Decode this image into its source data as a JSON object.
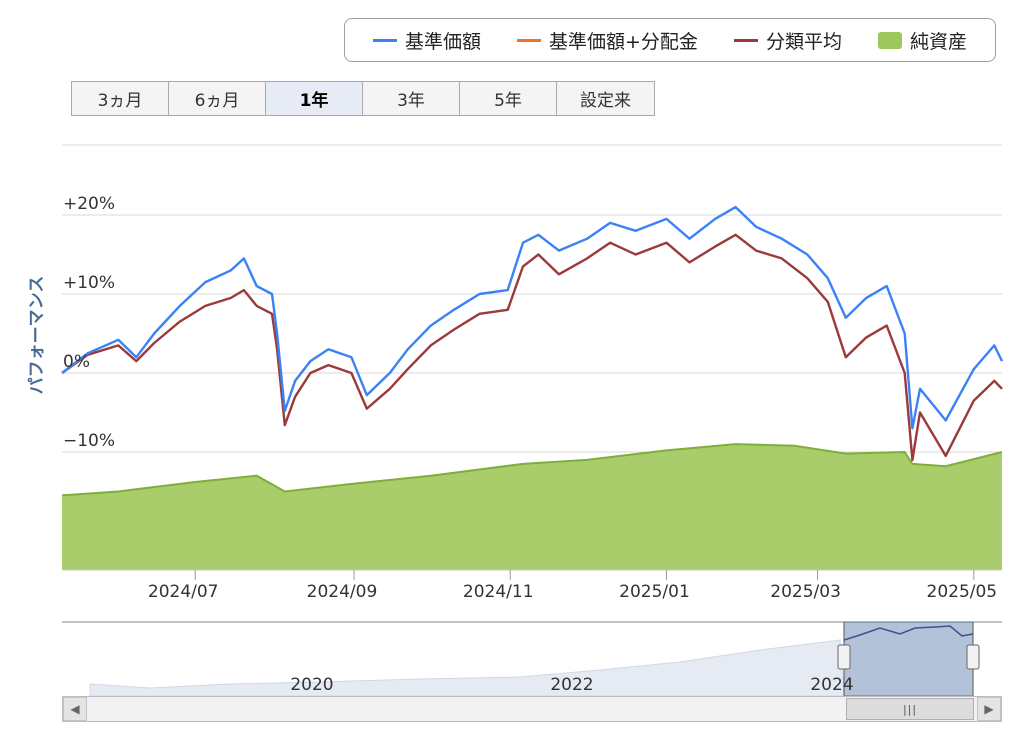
{
  "legend": [
    {
      "label": "基準価額",
      "color": "#3b82f6",
      "kind": "line"
    },
    {
      "label": "基準価額+分配金",
      "color": "#f07030",
      "kind": "line"
    },
    {
      "label": "分類平均",
      "color": "#9b3a3a",
      "kind": "line"
    },
    {
      "label": "純資産",
      "color": "#9cc75a",
      "kind": "area"
    }
  ],
  "range_buttons": [
    {
      "label": "3ヵ月",
      "active": false
    },
    {
      "label": "6ヵ月",
      "active": false
    },
    {
      "label": "1年",
      "active": true
    },
    {
      "label": "3年",
      "active": false
    },
    {
      "label": "5年",
      "active": false
    },
    {
      "label": "設定来",
      "active": false
    }
  ],
  "chart_data": {
    "type": "line",
    "ylabel": "パフォーマンス",
    "ylim": [
      -10,
      25
    ],
    "y_ticks": [
      "+20%",
      "+10%",
      "0%",
      "−10%"
    ],
    "x_ticks": [
      "2024/07",
      "2024/09",
      "2024/11",
      "2025/01",
      "2025/03",
      "2025/05"
    ],
    "x_range": [
      "2024-05-10",
      "2025-05-12"
    ],
    "grid": true,
    "legend_placement": "top-right",
    "series": [
      {
        "name": "基準価額",
        "color": "#3b82f6",
        "points": [
          [
            "2024-05-10",
            0.0
          ],
          [
            "2024-05-20",
            2.5
          ],
          [
            "2024-06-01",
            4.2
          ],
          [
            "2024-06-08",
            2.0
          ],
          [
            "2024-06-15",
            5.0
          ],
          [
            "2024-06-25",
            8.5
          ],
          [
            "2024-07-05",
            11.5
          ],
          [
            "2024-07-15",
            13.0
          ],
          [
            "2024-07-20",
            14.5
          ],
          [
            "2024-07-25",
            11.0
          ],
          [
            "2024-07-31",
            10.0
          ],
          [
            "2024-08-02",
            5.0
          ],
          [
            "2024-08-05",
            -4.8
          ],
          [
            "2024-08-09",
            -1.0
          ],
          [
            "2024-08-15",
            1.5
          ],
          [
            "2024-08-22",
            3.0
          ],
          [
            "2024-08-31",
            2.0
          ],
          [
            "2024-09-06",
            -2.8
          ],
          [
            "2024-09-15",
            0.0
          ],
          [
            "2024-09-22",
            3.0
          ],
          [
            "2024-10-01",
            6.0
          ],
          [
            "2024-10-10",
            8.0
          ],
          [
            "2024-10-20",
            10.0
          ],
          [
            "2024-10-31",
            10.5
          ],
          [
            "2024-11-06",
            16.5
          ],
          [
            "2024-11-12",
            17.5
          ],
          [
            "2024-11-20",
            15.5
          ],
          [
            "2024-12-01",
            17.0
          ],
          [
            "2024-12-10",
            19.0
          ],
          [
            "2024-12-20",
            18.0
          ],
          [
            "2025-01-01",
            19.5
          ],
          [
            "2025-01-10",
            17.0
          ],
          [
            "2025-01-20",
            19.5
          ],
          [
            "2025-01-28",
            21.0
          ],
          [
            "2025-02-05",
            18.5
          ],
          [
            "2025-02-15",
            17.0
          ],
          [
            "2025-02-25",
            15.0
          ],
          [
            "2025-03-05",
            12.0
          ],
          [
            "2025-03-12",
            7.0
          ],
          [
            "2025-03-20",
            9.5
          ],
          [
            "2025-03-28",
            11.0
          ],
          [
            "2025-04-04",
            5.0
          ],
          [
            "2025-04-07",
            -7.0
          ],
          [
            "2025-04-10",
            -2.0
          ],
          [
            "2025-04-20",
            -6.0
          ],
          [
            "2025-05-01",
            0.5
          ],
          [
            "2025-05-09",
            3.5
          ],
          [
            "2025-05-12",
            1.5
          ]
        ]
      },
      {
        "name": "分類平均",
        "color": "#9b3a3a",
        "points": [
          [
            "2024-05-10",
            0.0
          ],
          [
            "2024-05-20",
            2.3
          ],
          [
            "2024-06-01",
            3.5
          ],
          [
            "2024-06-08",
            1.5
          ],
          [
            "2024-06-15",
            3.8
          ],
          [
            "2024-06-25",
            6.5
          ],
          [
            "2024-07-05",
            8.5
          ],
          [
            "2024-07-15",
            9.5
          ],
          [
            "2024-07-20",
            10.5
          ],
          [
            "2024-07-25",
            8.5
          ],
          [
            "2024-07-31",
            7.5
          ],
          [
            "2024-08-02",
            3.0
          ],
          [
            "2024-08-05",
            -6.6
          ],
          [
            "2024-08-09",
            -3.0
          ],
          [
            "2024-08-15",
            0.0
          ],
          [
            "2024-08-22",
            1.0
          ],
          [
            "2024-08-31",
            0.0
          ],
          [
            "2024-09-06",
            -4.5
          ],
          [
            "2024-09-15",
            -2.0
          ],
          [
            "2024-09-22",
            0.5
          ],
          [
            "2024-10-01",
            3.5
          ],
          [
            "2024-10-10",
            5.5
          ],
          [
            "2024-10-20",
            7.5
          ],
          [
            "2024-10-31",
            8.0
          ],
          [
            "2024-11-06",
            13.5
          ],
          [
            "2024-11-12",
            15.0
          ],
          [
            "2024-11-20",
            12.5
          ],
          [
            "2024-12-01",
            14.5
          ],
          [
            "2024-12-10",
            16.5
          ],
          [
            "2024-12-20",
            15.0
          ],
          [
            "2025-01-01",
            16.5
          ],
          [
            "2025-01-10",
            14.0
          ],
          [
            "2025-01-20",
            16.0
          ],
          [
            "2025-01-28",
            17.5
          ],
          [
            "2025-02-05",
            15.5
          ],
          [
            "2025-02-15",
            14.5
          ],
          [
            "2025-02-25",
            12.0
          ],
          [
            "2025-03-05",
            9.0
          ],
          [
            "2025-03-12",
            2.0
          ],
          [
            "2025-03-20",
            4.5
          ],
          [
            "2025-03-28",
            6.0
          ],
          [
            "2025-04-04",
            0.0
          ],
          [
            "2025-04-07",
            -11.0
          ],
          [
            "2025-04-10",
            -5.0
          ],
          [
            "2025-04-20",
            -10.5
          ],
          [
            "2025-05-01",
            -3.5
          ],
          [
            "2025-05-09",
            -1.0
          ],
          [
            "2025-05-12",
            -2.0
          ]
        ]
      },
      {
        "name": "純資産",
        "color": "#9cc75a",
        "points": [
          [
            "2024-05-10",
            -15.5
          ],
          [
            "2024-06-01",
            -15.0
          ],
          [
            "2024-07-01",
            -13.8
          ],
          [
            "2024-07-25",
            -13.0
          ],
          [
            "2024-08-05",
            -15.0
          ],
          [
            "2024-09-01",
            -14.0
          ],
          [
            "2024-10-01",
            -13.0
          ],
          [
            "2024-11-06",
            -11.5
          ],
          [
            "2024-12-01",
            -11.0
          ],
          [
            "2025-01-01",
            -9.8
          ],
          [
            "2025-01-28",
            -9.0
          ],
          [
            "2025-02-20",
            -9.2
          ],
          [
            "2025-03-12",
            -10.2
          ],
          [
            "2025-04-04",
            -10.0
          ],
          [
            "2025-04-07",
            -11.5
          ],
          [
            "2025-04-20",
            -11.8
          ],
          [
            "2025-05-12",
            -10.0
          ]
        ]
      }
    ]
  },
  "navigator": {
    "x_ticks": [
      "2020",
      "2022",
      "2024"
    ],
    "handle_label": "|||"
  }
}
